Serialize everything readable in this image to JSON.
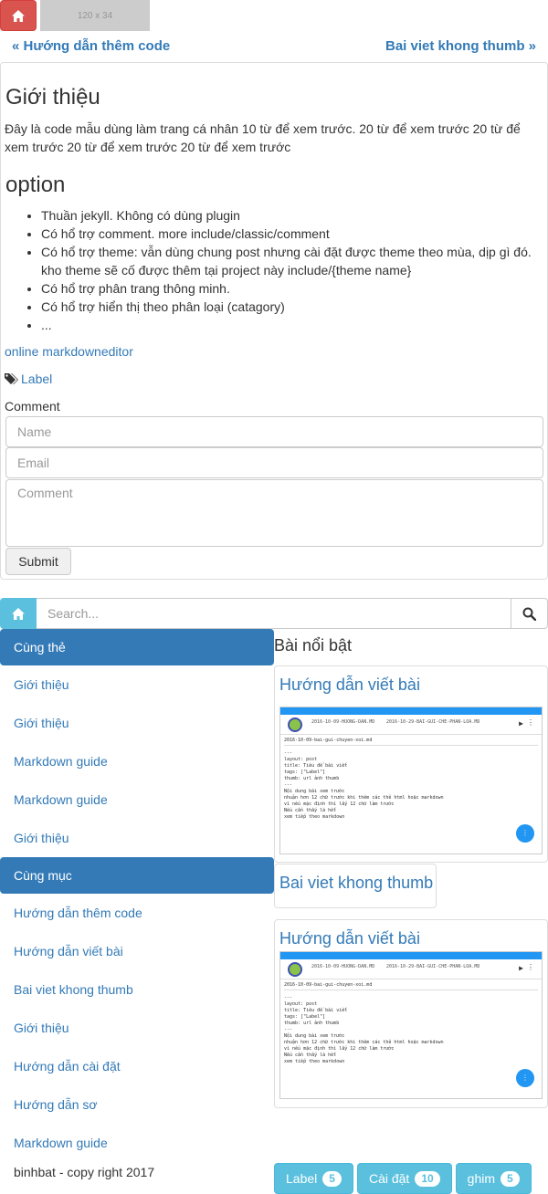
{
  "topbar": {
    "logo_placeholder": "120 x 34"
  },
  "pager": {
    "prev": "« Hướng dẫn thêm code",
    "next": "Bai viet khong thumb »"
  },
  "post": {
    "intro_title": "Giới thiệu",
    "intro_text": "Đây là code mẫu dùng làm trang cá nhân 10 từ để xem trước. 20 từ để xem trước 20 từ để xem trước 20 từ để xem trước 20 từ để xem trước",
    "option_title": "option",
    "options": [
      "Thuần jekyll. Không có dùng plugin",
      "Có hổ trợ comment. more include/classic/comment",
      "Có hổ trợ theme: vẫn dùng chung post nhưng cài đặt được theme theo mùa, dịp gì đó. kho theme sẽ cố được thêm tại project này include/{theme name}",
      "Có hổ trợ phân trang thông minh.",
      "Có hổ trợ hiển thị theo phân loại (catagory)",
      "..."
    ],
    "markdown_link": "online markdowneditor",
    "label": "Label",
    "comment_label": "Comment",
    "name_placeholder": "Name",
    "email_placeholder": "Email",
    "comment_placeholder": "Comment",
    "submit": "Submit"
  },
  "search": {
    "placeholder": "Search..."
  },
  "sidebar": {
    "same_tag_title": "Cùng thẻ",
    "same_tag_items": [
      "Giới thiệu",
      "Giới thiệu",
      "Markdown guide",
      "Markdown guide",
      "Giới thiệu"
    ],
    "same_cat_title": "Cùng mục",
    "same_cat_items": [
      "Hướng dẫn thêm code",
      "Hướng dẫn viết bài",
      "Bai viet khong thumb",
      "Giới thiệu",
      "Hướng dẫn cài đặt",
      "Hướng dẫn sơ",
      "Markdown guide"
    ],
    "copyright": "binhbat - copy right 2017"
  },
  "featured": {
    "title": "Bài nổi bật",
    "cards": [
      {
        "title": "Hướng dẫn viết bài"
      },
      {
        "title": "Bai viet khong thumb"
      },
      {
        "title": "Hướng dẫn viết bài"
      }
    ]
  },
  "thumbnail": {
    "header_left": "2016-10-09-HUONG-DAN.MD",
    "header_right": "2016-10-29-BAI-GUI-CHE-PHAN-LOA.MD",
    "file_path": "2016-10-09-bai-gui-chuyen-xoi.md",
    "code": "---\nlayout: post\ntitle: Tiêu đề bài viết\ntags: [\"Label\"]\nthumb: url ảnh thumb\n---\nNội dung bài xem trước\nnhuận hơn 12 chữ trước khi thêm các thẻ html hoặc markdown\nvì nếu mặc định thì lấy 12 chữ làm trước\nNếu cần thấy là hết\nxem tiếp theo markdown"
  },
  "tags": [
    {
      "label": "Label",
      "count": "5"
    },
    {
      "label": "Cài đặt",
      "count": "10"
    },
    {
      "label": "ghim",
      "count": "5"
    }
  ],
  "colors": {
    "primary": "#337ab7",
    "info": "#5bc0de",
    "danger": "#d9534f"
  }
}
